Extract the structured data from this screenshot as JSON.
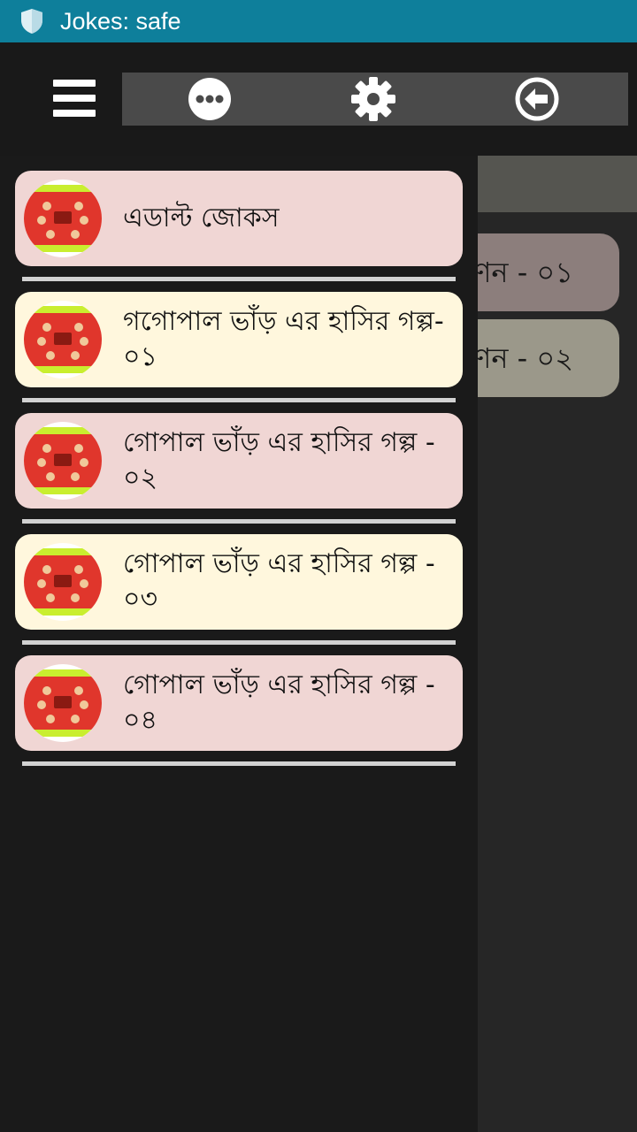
{
  "status_bar": {
    "title": "Jokes: safe"
  },
  "colors": {
    "status_bar": "#0e7f9b",
    "background": "#191919",
    "toolbar": "#4a4a4a",
    "card_pink": "#f0d6d4",
    "card_cream": "#fff7dd"
  },
  "toolbar": {
    "menu_icon": "hamburger-icon",
    "buttons": [
      {
        "icon": "more-icon"
      },
      {
        "icon": "gear-icon"
      },
      {
        "icon": "back-arrow-icon"
      }
    ]
  },
  "background_list": {
    "items": [
      {
        "label": "ণন - ০১"
      },
      {
        "label": "ণন - ০২"
      }
    ]
  },
  "drawer": {
    "items": [
      {
        "label": "এডাল্ট জোকস",
        "icon": "bangla-jokes-logo-icon"
      },
      {
        "label": "গগোপাল ভাঁড় এর হাসির গল্প- ০১",
        "icon": "bangla-jokes-logo-icon"
      },
      {
        "label": "গোপাল ভাঁড় এর হাসির গল্প - ০২",
        "icon": "bangla-jokes-logo-icon"
      },
      {
        "label": "গোপাল ভাঁড় এর হাসির গল্প - ০৩",
        "icon": "bangla-jokes-logo-icon"
      },
      {
        "label": "গোপাল ভাঁড় এর হাসির গল্প - ০৪",
        "icon": "bangla-jokes-logo-icon"
      }
    ]
  }
}
